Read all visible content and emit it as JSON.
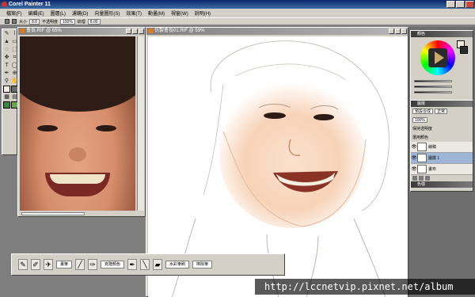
{
  "app": {
    "title": "Corel Painter 11"
  },
  "menu": [
    "檔案(F)",
    "編輯(E)",
    "圖層(L)",
    "濾鏡(D)",
    "向量圖形(S)",
    "效果(T)",
    "動畫(M)",
    "視窗(W)",
    "說明(H)"
  ],
  "property_bar": {
    "size_label": "大小",
    "size_value": "8.0",
    "opacity_label": "不透明度",
    "opacity_value": "100%",
    "grain_label": "紋理",
    "grain_value": "8.00"
  },
  "documents": {
    "photo": {
      "title": "會長.RIF @ 65%"
    },
    "sketch": {
      "title": "仿製會長01.RIF @ 59%"
    }
  },
  "panels": {
    "color": {
      "title": "顏色"
    },
    "layers": {
      "title": "圖層",
      "composite": "預設合成",
      "method": "正常",
      "opacity": "100%",
      "options": [
        "保持透明度",
        "選用顏色"
      ],
      "items": [
        {
          "name": "線稿",
          "visible": true,
          "selected": false
        },
        {
          "name": "圖層 1",
          "visible": true,
          "selected": true
        },
        {
          "name": "畫布",
          "visible": true,
          "selected": false
        }
      ]
    },
    "colors_footer": {
      "title": "色樣"
    }
  },
  "brush_bar": {
    "labels": [
      "畫筆",
      "克隆顏色",
      "水彩筆刷",
      "擦除筆"
    ]
  },
  "watermark": "http://lccnetvip.pixnet.net/album",
  "colors": {
    "title_bar": "#0a246a",
    "chrome": "#d4d0c8",
    "workspace": "#7f7f7f"
  }
}
